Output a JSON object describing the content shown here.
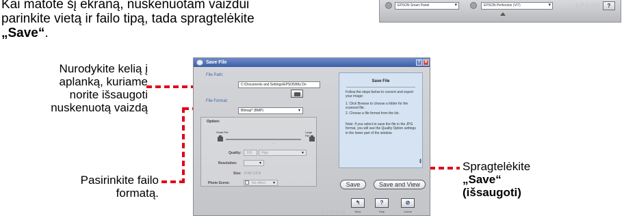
{
  "intro": {
    "line1": "Kai matote šį ekraną, nuskenuotam vaizdui",
    "line2": "parinkite vietą ir failo tipą, tada spragtelėkite",
    "quote_save": "„Save“",
    "period": "."
  },
  "callouts": {
    "path": [
      "Nurodykite kelią į",
      "aplanką, kuriame",
      "norite išsaugoti",
      "nuskenuotą vaizdą"
    ],
    "format": [
      "Pasirinkite failo",
      "formatą."
    ],
    "save": [
      "Spragtelėkite",
      "„Save“",
      "(išsaugoti)"
    ]
  },
  "scanner_strip": {
    "combo1": "EPSON Smart Panel",
    "combo2": "EPSON Perfection (V/7)",
    "brand": "EPSON",
    "help_label": "?"
  },
  "dialog": {
    "title": "Save File",
    "file_path_label": "File Path:",
    "file_path_value": "C:\\Documents and Settings\\EPSON\\My Do",
    "file_format_label": "File Format:",
    "file_format_value": "Bitmap* (BMP)",
    "option_label": "Option:",
    "small_file": "Small File",
    "large_file": "Large File",
    "slider_marker": "--",
    "quality_label": "Quality:",
    "quality_value": "100",
    "quality_select": "High",
    "resolution_label": "Resolution:",
    "resolution_value": "",
    "size_label": "Size:",
    "size_value": "1548 118 B",
    "photo_scene_label": "Photo Scene:",
    "photo_scene_value": "No effect",
    "help": {
      "title": "Save File",
      "para1": "Follow the steps below to convert and export your image:",
      "para2": "1. Click Browse to choose a folder for the scanned file.",
      "para3": "2. Choose a file format from the list.",
      "para4": "Note: If you select to save the file in the JPG format, you will see the Quality Option settings in the lower part of the window."
    },
    "save_button": "Save",
    "save_view_button": "Save and View",
    "back_label": "Back",
    "help_label": "Help",
    "cancel_label": "Cancel",
    "watermark": "EPSON"
  },
  "colors": {
    "callout_line": "#e2001a",
    "title_bar": "#3c5ea8",
    "help_panel": "#d5e3f2"
  }
}
